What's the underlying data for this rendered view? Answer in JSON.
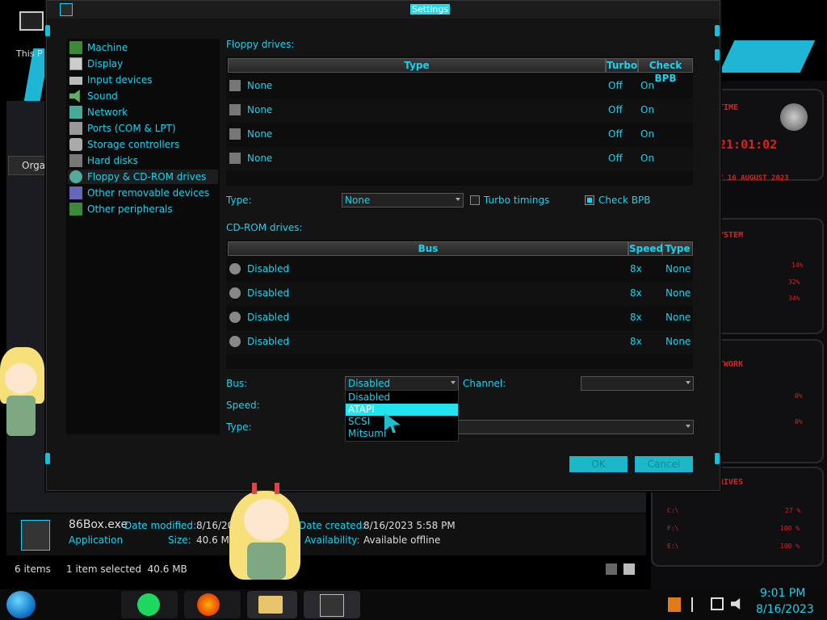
{
  "dialog": {
    "title": "Settings",
    "ok_label": "OK",
    "cancel_label": "Cancel"
  },
  "sidebar": {
    "items": [
      {
        "label": "Machine",
        "icon": "machine-icon"
      },
      {
        "label": "Display",
        "icon": "display-icon"
      },
      {
        "label": "Input devices",
        "icon": "keyboard-icon"
      },
      {
        "label": "Sound",
        "icon": "speaker-icon"
      },
      {
        "label": "Network",
        "icon": "network-icon"
      },
      {
        "label": "Ports (COM & LPT)",
        "icon": "port-icon"
      },
      {
        "label": "Storage controllers",
        "icon": "storage-icon"
      },
      {
        "label": "Hard disks",
        "icon": "hard-disk-icon"
      },
      {
        "label": "Floppy & CD-ROM drives",
        "icon": "floppy-cdrom-icon"
      },
      {
        "label": "Other removable devices",
        "icon": "removable-icon"
      },
      {
        "label": "Other peripherals",
        "icon": "chip-icon"
      }
    ],
    "selected_index": 8
  },
  "floppy": {
    "section_label": "Floppy drives:",
    "columns": [
      "Type",
      "Turbo",
      "Check BPB"
    ],
    "rows": [
      {
        "type": "None",
        "turbo": "Off",
        "check_bpb": "On"
      },
      {
        "type": "None",
        "turbo": "Off",
        "check_bpb": "On"
      },
      {
        "type": "None",
        "turbo": "Off",
        "check_bpb": "On"
      },
      {
        "type": "None",
        "turbo": "Off",
        "check_bpb": "On"
      }
    ],
    "type_label": "Type:",
    "type_value": "None",
    "turbo_timings_label": "Turbo timings",
    "turbo_timings_checked": false,
    "check_bpb_label": "Check BPB",
    "check_bpb_checked": true
  },
  "cdrom": {
    "section_label": "CD-ROM drives:",
    "columns": [
      "Bus",
      "Speed",
      "Type"
    ],
    "rows": [
      {
        "bus": "Disabled",
        "speed": "8x",
        "type": "None"
      },
      {
        "bus": "Disabled",
        "speed": "8x",
        "type": "None"
      },
      {
        "bus": "Disabled",
        "speed": "8x",
        "type": "None"
      },
      {
        "bus": "Disabled",
        "speed": "8x",
        "type": "None"
      }
    ],
    "bus_label": "Bus:",
    "bus_value": "Disabled",
    "channel_label": "Channel:",
    "speed_label": "Speed:",
    "type_label": "Type:",
    "bus_options": [
      "Disabled",
      "ATAPI",
      "SCSI",
      "Mitsumi"
    ],
    "highlighted_option": "ATAPI"
  },
  "explorer": {
    "file_name": "86Box.exe",
    "file_type": "Application",
    "date_modified_label": "Date modified:",
    "date_modified_value": "8/16/2023",
    "size_label": "Size:",
    "size_value": "40.6 MB",
    "date_created_label": "Date created:",
    "date_created_value": "8/16/2023 5:58 PM",
    "availability_label": "Availability:",
    "availability_value": "Available offline",
    "items_count": "6 items",
    "selection_status": "1 item selected  40.6 MB",
    "toolbar_fragment": "Orga",
    "desktop_label": "This P"
  },
  "widgets": {
    "time_label": "TIME",
    "time_value": "21:01:02",
    "date_value": "Y 16 AUGUST 2023",
    "system_label": "YSTEM",
    "system_values": [
      "14%",
      "32%",
      "34%"
    ],
    "network_label": "TWORK",
    "network_values": [
      "0%",
      "0%"
    ],
    "drives_label": "RIVES",
    "drives": [
      {
        "name": "C:\\",
        "value": "27 %"
      },
      {
        "name": "F:\\",
        "value": "100 %"
      },
      {
        "name": "E:\\",
        "value": "100 %"
      }
    ]
  },
  "taskbar": {
    "time": "9:01 PM",
    "date": "8/16/2023",
    "apps": [
      "start-orb",
      "spotify",
      "firefox",
      "file-explorer",
      "86box"
    ]
  },
  "colors": {
    "accent": "#19d2ee",
    "highlight": "#23e3f0",
    "widget_red": "#e0201a",
    "dialog_bg": "#141414"
  }
}
